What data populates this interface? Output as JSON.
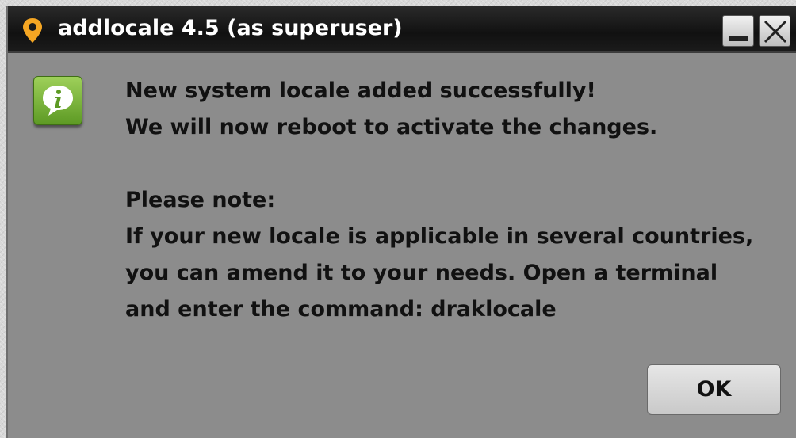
{
  "window": {
    "title": "addlocale 4.5 (as superuser)",
    "icons": {
      "app": "location-pin-icon",
      "minimize": "minimize-icon",
      "close": "close-icon",
      "info": "info-speech-bubble-icon"
    }
  },
  "dialog": {
    "lines": [
      "New system locale added successfully!",
      "We will now reboot to activate the changes.",
      "",
      "Please note:",
      "If your new locale is applicable in several countries,",
      "you can amend it to your needs. Open a terminal",
      "and enter the command: draklocale"
    ],
    "ok_label": "OK"
  },
  "colors": {
    "titlebar": "#111111",
    "window_bg": "#8c8c8c",
    "pin_accent": "#f5a623",
    "info_green": "#7fba3c"
  }
}
